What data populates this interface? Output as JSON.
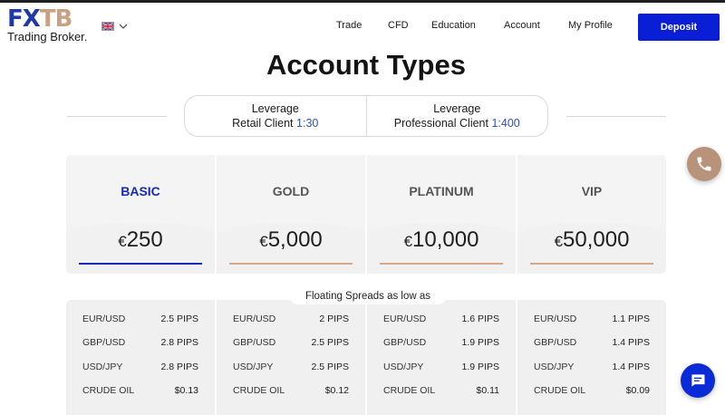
{
  "brand": {
    "logo_part1": "FX",
    "logo_part2": "TB",
    "tagline": "Trading Broker.",
    "colors": {
      "primary": "#0a1ed6",
      "accent": "#c8a082",
      "link": "#2b4fc7"
    }
  },
  "language": {
    "flag": "uk-flag-icon",
    "chevron": "chevron-down-icon"
  },
  "nav": {
    "items": [
      "Trade",
      "CFD",
      "Education",
      "Account",
      "My Profile"
    ],
    "deposit_label": "Deposit"
  },
  "page_title": "Account Types",
  "leverage": {
    "retail": {
      "label": "Leverage",
      "client": "Retail Client",
      "value": "1:30"
    },
    "professional": {
      "label": "Leverage",
      "client": "Professional Client",
      "value": "1:400"
    }
  },
  "plans": [
    {
      "name": "BASIC",
      "currency": "€",
      "amount": "250",
      "active": true
    },
    {
      "name": "GOLD",
      "currency": "€",
      "amount": "5,000",
      "active": false
    },
    {
      "name": "PLATINUM",
      "currency": "€",
      "amount": "10,000",
      "active": false
    },
    {
      "name": "VIP",
      "currency": "€",
      "amount": "50,000",
      "active": false
    }
  ],
  "spreads": {
    "label": "Floating Spreads as low as",
    "columns": [
      {
        "rows": [
          {
            "pair": "EUR/USD",
            "value": "2.5 PIPS"
          },
          {
            "pair": "GBP/USD",
            "value": "2.8 PIPS"
          },
          {
            "pair": "USD/JPY",
            "value": "2.8 PIPS"
          },
          {
            "pair": "CRUDE OIL",
            "value": "$0.13"
          }
        ]
      },
      {
        "rows": [
          {
            "pair": "EUR/USD",
            "value": "2 PIPS"
          },
          {
            "pair": "GBP/USD",
            "value": "2.5 PIPS"
          },
          {
            "pair": "USD/JPY",
            "value": "2.5 PIPS"
          },
          {
            "pair": "CRUDE OIL",
            "value": "$0.12"
          }
        ]
      },
      {
        "rows": [
          {
            "pair": "EUR/USD",
            "value": "1.6 PIPS"
          },
          {
            "pair": "GBP/USD",
            "value": "1.9 PIPS"
          },
          {
            "pair": "USD/JPY",
            "value": "1.9 PIPS"
          },
          {
            "pair": "CRUDE OIL",
            "value": "$0.11"
          }
        ]
      },
      {
        "rows": [
          {
            "pair": "EUR/USD",
            "value": "1.1 PIPS"
          },
          {
            "pair": "GBP/USD",
            "value": "1.4 PIPS"
          },
          {
            "pair": "USD/JPY",
            "value": "1.4 PIPS"
          },
          {
            "pair": "CRUDE OIL",
            "value": "$0.09"
          }
        ]
      }
    ]
  },
  "fabs": {
    "call_icon": "phone-icon",
    "chat_icon": "chat-icon"
  }
}
